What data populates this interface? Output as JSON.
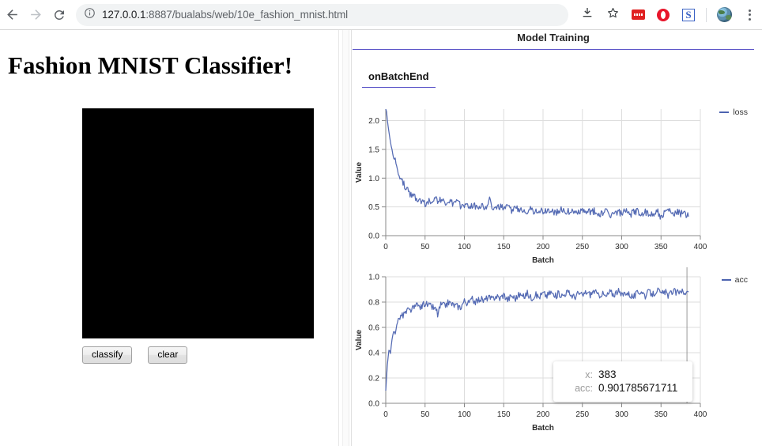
{
  "browser": {
    "back_icon": "arrow-left-icon",
    "forward_icon": "arrow-right-icon",
    "reload_icon": "reload-icon",
    "site_info_icon": "info-circle-icon",
    "url_host": "127.0.0.1",
    "url_rest": ":8887/bualabs/web/10e_fashion_mnist.html",
    "download_icon": "download-icon",
    "bookmark_icon": "star-icon",
    "extensions": [
      "red-note-extension-icon",
      "opera-extension-icon",
      "s-extension-icon"
    ],
    "profile_icon": "profile-avatar-icon",
    "menu_icon": "kebab-menu-icon"
  },
  "left": {
    "title": "Fashion MNIST Classifier!",
    "canvas_name": "drawing-canvas",
    "canvas_color": "#000000",
    "buttons": [
      {
        "label": "classify",
        "name": "classify-button"
      },
      {
        "label": "clear",
        "name": "clear-button"
      }
    ]
  },
  "visor": {
    "header": "Model Training",
    "accent_color": "#5b54c8",
    "tabs": [
      {
        "label": "onBatchEnd",
        "active": true
      }
    ]
  },
  "tooltip": {
    "rows": [
      {
        "key": "x:",
        "value": "383"
      },
      {
        "key": "acc:",
        "value": "0.901785671711"
      }
    ]
  },
  "chart_data": [
    {
      "type": "line",
      "name": "loss-chart",
      "title": "",
      "xlabel": "Batch",
      "ylabel": "Value",
      "xlim": [
        0,
        400
      ],
      "ylim": [
        0.0,
        2.2
      ],
      "xticks": [
        0,
        50,
        100,
        150,
        200,
        250,
        300,
        350,
        400
      ],
      "yticks": [
        "0.0",
        "0.5",
        "1.0",
        "1.5",
        "2.0"
      ],
      "grid": true,
      "legend": [
        "loss"
      ],
      "legend_position": "right",
      "series_color": "#4c63b0",
      "series": [
        {
          "name": "loss",
          "x": [
            0,
            2,
            4,
            6,
            8,
            10,
            12,
            14,
            16,
            18,
            20,
            22,
            24,
            26,
            28,
            30,
            32,
            34,
            36,
            38,
            40,
            42,
            44,
            46,
            48,
            50,
            55,
            60,
            62,
            64,
            66,
            70,
            75,
            80,
            85,
            90,
            95,
            100,
            105,
            110,
            115,
            120,
            125,
            130,
            132,
            135,
            140,
            145,
            150,
            155,
            160,
            165,
            170,
            175,
            180,
            185,
            190,
            195,
            200,
            205,
            210,
            215,
            220,
            225,
            230,
            235,
            240,
            245,
            250,
            255,
            260,
            265,
            270,
            275,
            280,
            285,
            290,
            295,
            300,
            305,
            310,
            315,
            320,
            325,
            330,
            335,
            340,
            345,
            350,
            355,
            360,
            365,
            370,
            375,
            380,
            383,
            385
          ],
          "values": [
            2.3,
            2.02,
            1.8,
            1.62,
            1.48,
            1.35,
            1.33,
            1.22,
            1.1,
            1.02,
            0.96,
            0.92,
            0.88,
            0.82,
            0.78,
            0.74,
            0.72,
            0.68,
            0.7,
            0.66,
            0.63,
            0.66,
            0.6,
            0.62,
            0.58,
            0.55,
            0.6,
            0.62,
            0.71,
            0.66,
            0.58,
            0.62,
            0.57,
            0.6,
            0.55,
            0.58,
            0.52,
            0.55,
            0.51,
            0.54,
            0.5,
            0.53,
            0.49,
            0.55,
            0.62,
            0.52,
            0.47,
            0.5,
            0.46,
            0.49,
            0.45,
            0.48,
            0.44,
            0.47,
            0.43,
            0.46,
            0.42,
            0.45,
            0.41,
            0.44,
            0.45,
            0.4,
            0.43,
            0.46,
            0.4,
            0.43,
            0.39,
            0.42,
            0.44,
            0.38,
            0.41,
            0.43,
            0.37,
            0.4,
            0.42,
            0.36,
            0.39,
            0.41,
            0.38,
            0.42,
            0.36,
            0.4,
            0.44,
            0.37,
            0.41,
            0.35,
            0.39,
            0.43,
            0.3,
            0.4,
            0.44,
            0.36,
            0.41,
            0.38,
            0.43,
            0.34,
            0.33
          ]
        }
      ]
    },
    {
      "type": "line",
      "name": "accuracy-chart",
      "title": "",
      "xlabel": "Batch",
      "ylabel": "Value",
      "xlim": [
        0,
        400
      ],
      "ylim": [
        0.0,
        1.0
      ],
      "xticks": [
        0,
        50,
        100,
        150,
        200,
        250,
        300,
        350,
        400
      ],
      "yticks": [
        "0.0",
        "0.2",
        "0.4",
        "0.6",
        "0.8",
        "1.0"
      ],
      "grid": true,
      "legend": [
        "acc"
      ],
      "legend_position": "right",
      "series_color": "#4c63b0",
      "crosshair_x": 383,
      "series": [
        {
          "name": "acc",
          "x": [
            0,
            2,
            4,
            6,
            8,
            10,
            12,
            14,
            16,
            18,
            20,
            22,
            24,
            26,
            28,
            30,
            35,
            40,
            45,
            50,
            55,
            60,
            65,
            66,
            70,
            75,
            80,
            85,
            90,
            95,
            100,
            105,
            110,
            115,
            120,
            125,
            130,
            135,
            140,
            145,
            150,
            155,
            160,
            165,
            170,
            175,
            180,
            185,
            190,
            195,
            200,
            205,
            210,
            215,
            220,
            225,
            230,
            235,
            240,
            245,
            250,
            255,
            260,
            265,
            270,
            275,
            280,
            285,
            290,
            295,
            300,
            305,
            310,
            315,
            320,
            325,
            330,
            335,
            340,
            345,
            350,
            355,
            360,
            365,
            370,
            375,
            380,
            383,
            385
          ],
          "values": [
            0.1,
            0.3,
            0.42,
            0.4,
            0.5,
            0.57,
            0.55,
            0.63,
            0.66,
            0.68,
            0.7,
            0.69,
            0.72,
            0.71,
            0.74,
            0.73,
            0.75,
            0.77,
            0.76,
            0.79,
            0.77,
            0.76,
            0.73,
            0.7,
            0.78,
            0.77,
            0.8,
            0.78,
            0.77,
            0.76,
            0.81,
            0.79,
            0.82,
            0.8,
            0.83,
            0.81,
            0.84,
            0.82,
            0.85,
            0.83,
            0.86,
            0.82,
            0.85,
            0.83,
            0.86,
            0.84,
            0.87,
            0.83,
            0.86,
            0.84,
            0.87,
            0.85,
            0.88,
            0.84,
            0.87,
            0.85,
            0.88,
            0.86,
            0.84,
            0.87,
            0.85,
            0.88,
            0.86,
            0.89,
            0.85,
            0.87,
            0.84,
            0.88,
            0.86,
            0.89,
            0.85,
            0.88,
            0.86,
            0.84,
            0.87,
            0.89,
            0.85,
            0.88,
            0.86,
            0.9,
            0.86,
            0.88,
            0.85,
            0.89,
            0.87,
            0.9,
            0.86,
            0.9,
            0.88
          ]
        }
      ]
    }
  ]
}
